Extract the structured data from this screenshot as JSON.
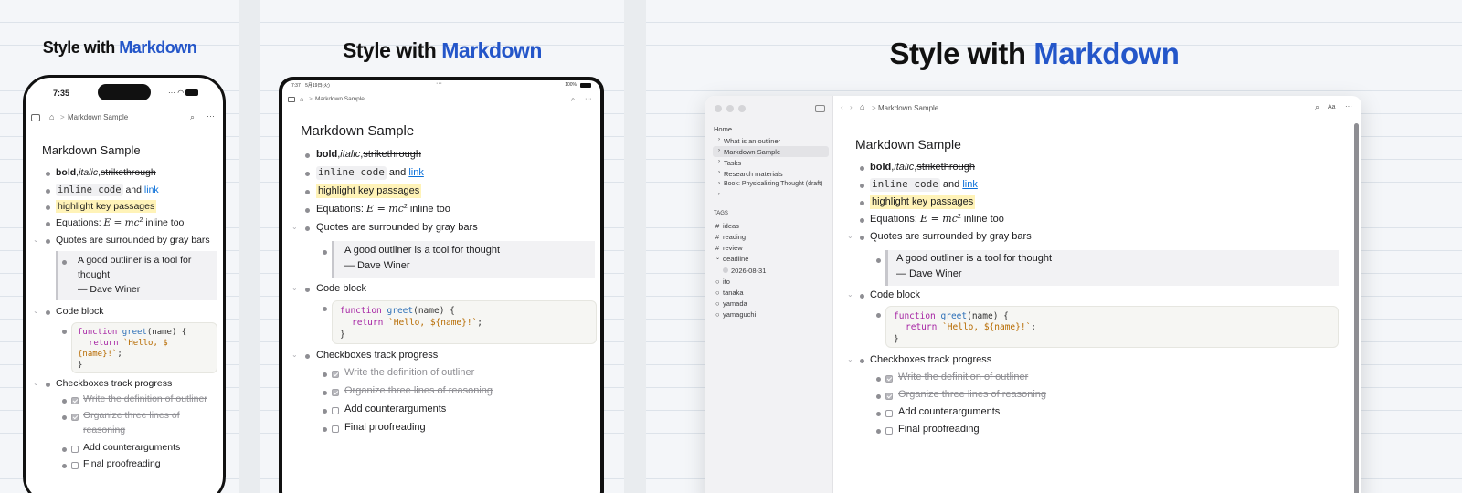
{
  "headline": {
    "prefix": "Style with ",
    "accent": "Markdown"
  },
  "status": {
    "time": "7:35",
    "tablet_time": "7:37",
    "tablet_date": "5月19日(火)",
    "battery": "100%"
  },
  "breadcrumb": {
    "page": "Markdown Sample",
    "separator": ">"
  },
  "doc": {
    "title": "Markdown Sample",
    "line1": {
      "bold": "bold",
      "sep1": ", ",
      "italic": "italic",
      "sep2": ", ",
      "strike": "strikethrough"
    },
    "line2": {
      "code": "inline code",
      "mid": " and ",
      "link": "link"
    },
    "line3": {
      "highlight": "highlight key passages"
    },
    "line4": {
      "label": "Equations: ",
      "eq": "E = mc",
      "sup": "2",
      "tail": " inline too"
    },
    "quotes_heading": "Quotes are surrounded by gray bars",
    "quote_text": "A good outliner is a tool for thought",
    "quote_author": "— Dave Winer",
    "code_heading": "Code block",
    "code": {
      "kw1": "function",
      "fn": "greet",
      "args": "(name) {",
      "kw2": "return",
      "str": "`Hello, ${name}!`",
      "semi": ";",
      "close": "}",
      "str_a": "`Hello, $",
      "str_b": "{name}!`"
    },
    "check_heading": "Checkboxes track progress",
    "tasks": [
      {
        "label": "Write the definition of outliner",
        "done": true
      },
      {
        "label": "Organize three lines of reasoning",
        "done": true
      },
      {
        "label": "Add counterarguments",
        "done": false
      },
      {
        "label": "Final proofreading",
        "done": false
      }
    ],
    "task2_a": "Organize three lines of",
    "task2_b": "reasoning",
    "quote_a": "A good outliner is a tool for",
    "quote_b": "thought"
  },
  "sidebar": {
    "home": "Home",
    "pages": [
      "What is an outliner",
      "Markdown Sample",
      "Tasks",
      "Research materials",
      "Book: Physicalizing Thought (draft)"
    ],
    "tags_heading": "TAGS",
    "tags": [
      "ideas",
      "reading",
      "review",
      "deadline",
      "2026-08-31",
      "ito",
      "tanaka",
      "yamada",
      "yamaguchi"
    ]
  },
  "toolbar": {
    "aa": "Aa"
  },
  "icons": {
    "sidebar-toggle": "sidebar-icon",
    "home": "house-icon",
    "search": "magnifier-icon",
    "more": "ellipsis-icon",
    "back": "chevron-left-icon",
    "forward": "chevron-right-icon",
    "tag": "hash-icon"
  },
  "colors": {
    "accent": "#2456c9",
    "link": "#0a6fd8",
    "highlight": "#fff3b8",
    "keyword": "#a625a4",
    "function": "#2c6fb7",
    "string": "#b76b01"
  }
}
